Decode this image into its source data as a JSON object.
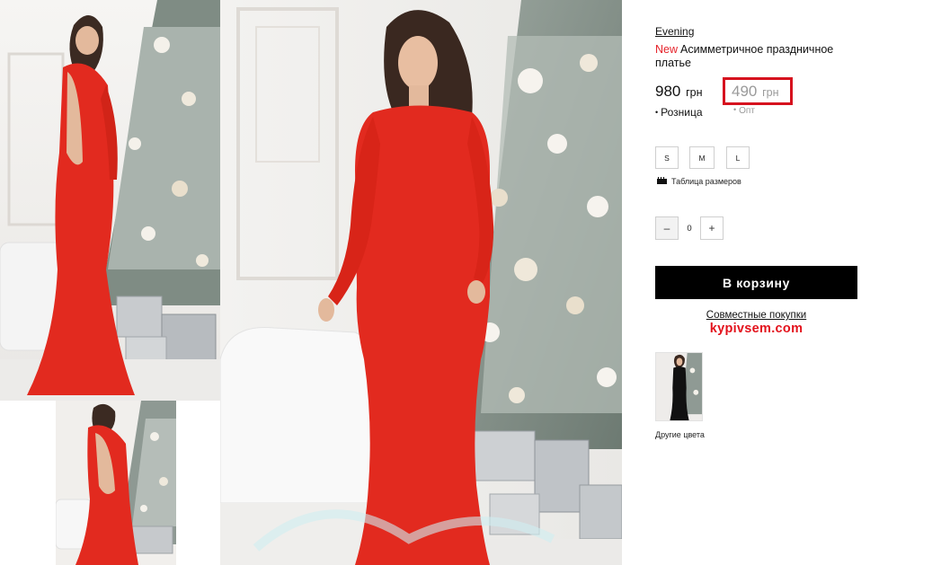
{
  "product": {
    "brand": "Evening",
    "new_badge": "New",
    "title": "Асимметричное праздничное платье",
    "dress_color": "#e22a1f",
    "alt_color": "#111111"
  },
  "prices": {
    "retail_value": "980",
    "retail_currency": "грн",
    "retail_label": "Розница",
    "opt_value": "490",
    "opt_currency": "грн",
    "opt_label": "Опт",
    "highlight_color": "#d6111e"
  },
  "sizes": [
    "S",
    "M",
    "L"
  ],
  "size_table_label": "Таблица размеров",
  "quantity": {
    "minus_label": "–",
    "value": "0",
    "plus_label": "+"
  },
  "cart_button_label": "В корзину",
  "joint_purchase": {
    "link_label": "Совместные покупки",
    "site_label": "kypivsem.com"
  },
  "other_colors_label": "Другие цвета",
  "icons": [
    "ruler-icon",
    "minus-icon",
    "plus-icon"
  ]
}
